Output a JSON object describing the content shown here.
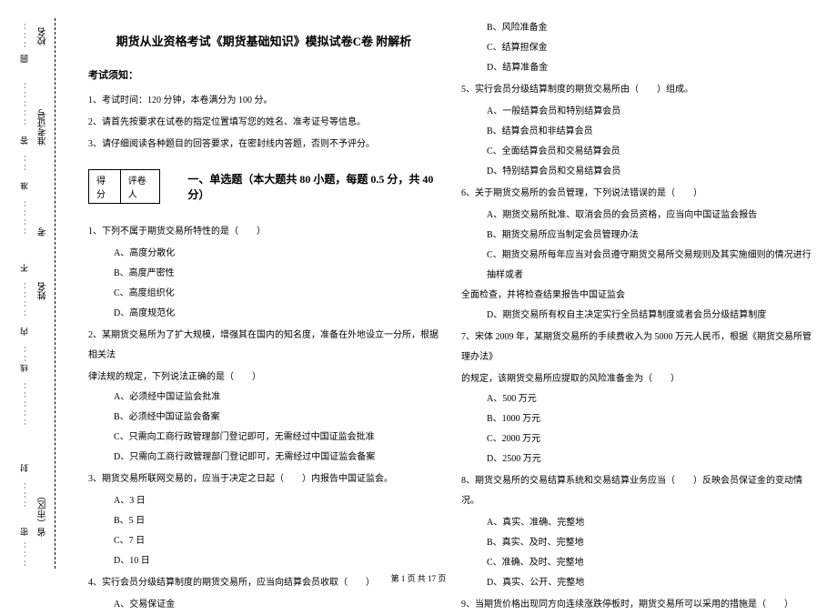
{
  "binding": {
    "labels": [
      "校名",
      "准考证号",
      "考",
      "姓名",
      "省（市区）"
    ],
    "cutline": [
      "圆",
      "答",
      "准",
      "不",
      "内",
      "线",
      "封",
      "密"
    ]
  },
  "header": {
    "title": "期货从业资格考试《期货基础知识》模拟试卷C卷 附解析"
  },
  "notice": {
    "head": "考试须知：",
    "items": [
      "1、考试时间：120 分钟，本卷满分为 100 分。",
      "2、请首先按要求在试卷的指定位置填写您的姓名、准考证号等信息。",
      "3、请仔细阅读各种题目的回答要求，在密封线内答题，否则不予评分。"
    ]
  },
  "scorebox": {
    "c1": "得分",
    "c2": "评卷人"
  },
  "section1": {
    "title": "一、单选题（本大题共 80 小题，每题 0.5 分，共 40 分）"
  },
  "left": {
    "q1": {
      "stem": "1、下列不属于期货交易所特性的是（　　）",
      "a": "A、高度分散化",
      "b": "B、高度严密性",
      "c": "C、高度组织化",
      "d": "D、高度规范化"
    },
    "q2": {
      "stem1": "2、某期货交易所为了扩大规模，增强其在国内的知名度，准备在外地设立一分所，根据相关法",
      "stem2": "律法规的规定，下列说法正确的是（　　）",
      "a": "A、必须经中国证监会批准",
      "b": "B、必须经中国证监会备案",
      "c": "C、只需向工商行政管理部门登记即可，无需经过中国证监会批准",
      "d": "D、只需向工商行政管理部门登记即可，无需经过中国证监会备案"
    },
    "q3": {
      "stem": "3、期货交易所联网交易的，应当于决定之日起（　　）内报告中国证监会。",
      "a": "A、3 日",
      "b": "B、5 日",
      "c": "C、7 日",
      "d": "D、10 日"
    },
    "q4": {
      "stem": "4、实行会员分级结算制度的期货交易所，应当向结算会员收取（　　）",
      "a": "A、交易保证金"
    }
  },
  "right": {
    "q4": {
      "b": "B、风险准备金",
      "c": "C、结算担保金",
      "d": "D、结算准备金"
    },
    "q5": {
      "stem": "5、实行会员分级结算制度的期货交易所由（　　）组成。",
      "a": "A、一般结算会员和特别结算会员",
      "b": "B、结算会员和非结算会员",
      "c": "C、全面结算会员和交易结算会员",
      "d": "D、特别结算会员和交易结算会员"
    },
    "q6": {
      "stem": "6、关于期货交易所的会员管理，下列说法错误的是（　　）",
      "a": "A、期货交易所批准、取消会员的会员资格，应当向中国证监会报告",
      "b": "B、期货交易所应当制定会员管理办法",
      "c1": "C、期货交易所每年应当对会员遵守期货交易所交易规则及其实施细则的情况进行抽样或者",
      "c2": "全面检查，并将检查结果报告中国证监会",
      "d": "D、期货交易所有权自主决定实行全员结算制度或者会员分级结算制度"
    },
    "q7": {
      "stem1": "7、宋体 2009 年，某期货交易所的手续费收入为 5000 万元人民币，根据《期货交易所管理办法》",
      "stem2": "的规定，该期货交易所应提取的风险准备金为（　　）",
      "a": "A、500 万元",
      "b": "B、1000 万元",
      "c": "C、2000 万元",
      "d": "D、2500 万元"
    },
    "q8": {
      "stem": "8、期货交易所的交易结算系统和交易结算业务应当（　　）反映会员保证金的变动情况。",
      "a": "A、真实、准确、完整地",
      "b": "B、真实、及时、完整地",
      "c": "C、准确、及时、完整地",
      "d": "D、真实、公开、完整地"
    },
    "q9": {
      "stem": "9、当期货价格出现同方向连续涨跌停板时，期货交易所可以采用的措施是（　　）"
    }
  },
  "footer": "第 1 页 共 17 页"
}
